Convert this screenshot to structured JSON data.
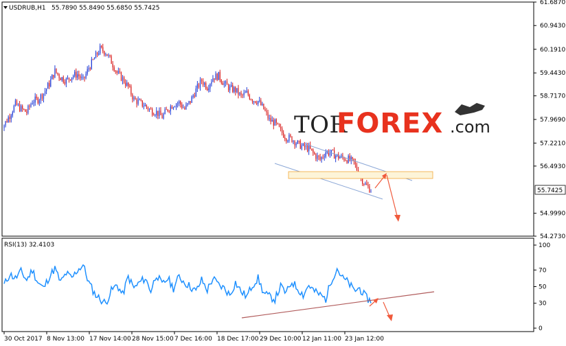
{
  "header": {
    "symbol": "USDRUB,H1",
    "ohlc": "55.7890 55.8490 55.6850 55.7425",
    "indicator": "RSI(13) 32.4103"
  },
  "watermark": {
    "part1": "TOR",
    "part2": "FOREX",
    "part3": ".com"
  },
  "colors": {
    "up": "#1f3bd6",
    "down": "#d81c1c",
    "rsi": "#1e90ff",
    "channel": "#8aa6d6",
    "zone_fill": "#fdf4d8",
    "zone_border": "#f2a93b",
    "arrow": "#f05a3c",
    "trend": "#b05a5a",
    "price_box": "#ffffff"
  },
  "chart_data": [
    {
      "type": "candlestick",
      "title": "USDRUB,H1",
      "ylim": [
        54.273,
        61.687
      ],
      "yticks": [
        "61.6870",
        "60.9430",
        "60.1910",
        "59.4430",
        "58.7170",
        "57.9690",
        "57.2210",
        "56.4930",
        "55.7425",
        "54.9990",
        "54.2730"
      ],
      "xticks": [
        "30 Oct 2017",
        "8 Nov 13:00",
        "17 Nov 14:00",
        "28 Nov 15:00",
        "7 Dec 16:00",
        "18 Dec 17:00",
        "29 Dec 10:00",
        "12 Jan 11:00",
        "23 Jan 12:00"
      ],
      "current_price": "55.7425",
      "series": [
        {
          "values": [
            57.8,
            58.1,
            58.45,
            58.3,
            58.2,
            58.55,
            58.6,
            58.8,
            59.1,
            59.5,
            59.3,
            59.2,
            59.35,
            59.4,
            59.2,
            59.6,
            59.9,
            60.2,
            60.1,
            59.8,
            59.45,
            59.25,
            59.0,
            58.6,
            58.5,
            58.4,
            58.25,
            58.2,
            58.05,
            58.3,
            58.45,
            58.5,
            58.3,
            58.55,
            58.9,
            59.2,
            59.0,
            59.3,
            59.35,
            59.1,
            58.95,
            58.9,
            58.7,
            58.8,
            58.6,
            58.55,
            58.3,
            57.95,
            57.85,
            57.6,
            57.4,
            57.35,
            57.2,
            57.1,
            57.05,
            56.85,
            56.7,
            56.95,
            56.9,
            56.8,
            56.75,
            56.7,
            56.6,
            56.2,
            55.9,
            55.74
          ]
        }
      ]
    },
    {
      "type": "line",
      "title": "RSI(13) 32.4103",
      "ylim": [
        0,
        100
      ],
      "yticks": [
        "100",
        "70",
        "50",
        "30",
        "0"
      ],
      "series": [
        {
          "values": [
            52,
            65,
            60,
            68,
            58,
            70,
            55,
            48,
            62,
            72,
            55,
            66,
            60,
            70,
            76,
            55,
            42,
            35,
            30,
            45,
            52,
            40,
            62,
            48,
            55,
            60,
            45,
            65,
            52,
            60,
            48,
            62,
            55,
            50,
            44,
            58,
            46,
            60,
            52,
            48,
            40,
            55,
            44,
            38,
            52,
            60,
            42,
            38,
            35,
            50,
            42,
            56,
            48,
            40,
            52,
            44,
            40,
            35,
            58,
            72,
            60,
            55,
            45,
            48,
            38,
            32
          ]
        }
      ]
    }
  ]
}
